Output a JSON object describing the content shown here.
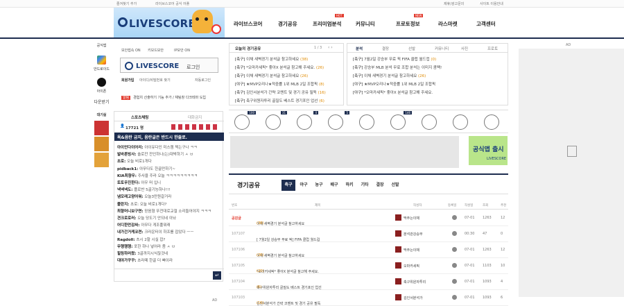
{
  "topbar": {
    "bookmark": "즐겨찾기 추가",
    "official": "라이브스코어 공식 어플",
    "terms": "제휴/광고문의",
    "sitemap": "사이트 이용안내"
  },
  "logo": {
    "text": "LIVESCORE"
  },
  "nav": [
    {
      "label": "라이브스코어"
    },
    {
      "label": "경기공유"
    },
    {
      "label": "프리미엄분석",
      "badge": "HOT"
    },
    {
      "label": "커뮤니티"
    },
    {
      "label": "프로토정보",
      "badge": "NEW"
    },
    {
      "label": "라스마켓"
    },
    {
      "label": "고객센터"
    }
  ],
  "rail": {
    "app": "공식앱",
    "android": "안드로이드",
    "iphone": "아이폰",
    "download": "다운받기",
    "free": "대기실"
  },
  "login": {
    "opt1": "보안접속 ON",
    "opt2": "키보드보안",
    "opt3": "IP보안 ON",
    "btn_logo": "LIVESCORE",
    "btn_label": "로그인",
    "join": "회원가입",
    "find": "아이디/비밀번호 찾기",
    "auto": "자동로그인",
    "info": "경험치 산출하기 기능 추가 / 채팅창 다크테마 도입"
  },
  "chat": {
    "tab1": "스포츠채팅",
    "tab2": "대화금지",
    "count": "17721 명",
    "notice": "욕&음란 금지, 음란글은 반드시 한줄로.",
    "lines": [
      {
        "user": "아이언다이어리:",
        "msg": "아이유다인 미스캠 찍는구나 ㅋㅋ"
      },
      {
        "user": "발바른빙사:",
        "msg": "솔로잔 잔인하나(는)대박하기 ㅅ ㅂ"
      },
      {
        "user": "초로:",
        "msg": "오늘 비로1개다"
      },
      {
        "user": "pidback1:",
        "msg": "아무다도 한골만하기~"
      },
      {
        "user": "KIA최향우:",
        "msg": "주사을 주라 오늘 ㅋㅋㅋㅋㅋㅋㅋㅋㅋ"
      },
      {
        "user": "토토우진한다:",
        "msg": "아우 머 입니"
      },
      {
        "user": "넥넥넥도:",
        "msg": "플로반 5골기능하나!!!"
      },
      {
        "user": "냄모래고양어워:",
        "msg": "오늘3만원갈거라"
      },
      {
        "user": "플란지:",
        "msg": "초로: 오늘 비로1개다?"
      },
      {
        "user": "최향머니보구면:",
        "msg": "믿음형 뚜전대로교절 소리들어야지 ㅋㅋㅋ"
      },
      {
        "user": "견크로로러:",
        "msg": "오늘 당도기 안되네 아놔"
      },
      {
        "user": "어디한먼감싸:",
        "msg": "아무다 게조풀뭐래"
      },
      {
        "user": "내가간거케코켠:",
        "msg": "크라운터이 하프를 잡았다 ㅡㅡ"
      },
      {
        "user": "Ragdoll:",
        "msg": "츠시 2할 시실 잡?"
      },
      {
        "user": "무행행행:",
        "msg": "포한 하나 넣어라 좀 ㅅ ㅂ"
      },
      {
        "user": "힐링하러왔:",
        "msg": "3골까지시식잖것네"
      },
      {
        "user": "대야가꾸꾸:",
        "msg": "초라떼 한골 더 빠이라"
      }
    ]
  },
  "board": {
    "tab": "오늘의 경기공유",
    "page": "1 / 3",
    "posts": [
      {
        "cat": "[축구]",
        "title": "이채  새벽경기 분석글 참고하세요",
        "cnt": "(38)"
      },
      {
        "cat": "[축구]",
        "title": "*오마카세픽* 좋아X 분석글 참고해 주세요.",
        "cnt": "(26)"
      },
      {
        "cat": "[축구]",
        "title": "이채  새벽경기 분석글 참고하세요",
        "cnt": "(26)"
      },
      {
        "cat": "[야구]",
        "title": "★MVP오리나★적중률 1위 MLB 2일 조합픽",
        "cnt": "(8)"
      },
      {
        "cat": "[축구]",
        "title": "김인서분석가  간략 코멘트 및 경기 공유 필독",
        "cnt": "(16)"
      },
      {
        "cat": "[축구]",
        "title": "축구위원자투리  골질도 베스트 경기포인 업선",
        "cnt": "(6)"
      }
    ]
  },
  "tabs2": {
    "tabs": [
      "분석",
      "결장",
      "선발",
      "커뮤니티",
      "사진",
      "프로토"
    ],
    "posts": [
      {
        "cat": "[축구]",
        "title": "7월2일 강승부 무료 픽 FIFA 클럽 월드컵",
        "cnt": "(0)"
      },
      {
        "cat": "[축구]",
        "title": "강승부  MLB 분석 무료 조합 분석는 이미지 콤팩!",
        "cnt": ""
      },
      {
        "cat": "[축구]",
        "title": "이채  새벽경기 분석글 참고하세요",
        "cnt": "(26)"
      },
      {
        "cat": "[야구]",
        "title": "★MVP오리나★적중률 1위 MLB 2일 조합픽",
        "cnt": ""
      },
      {
        "cat": "[야구]",
        "title": "*오마카세픽* 좋아X 분석글 참고해 주세요.",
        "cnt": ""
      },
      {
        "cat": "",
        "title": "",
        "cnt": ""
      }
    ]
  },
  "sports": [
    {
      "icon": "soccer-icon",
      "n": "100"
    },
    {
      "icon": "baseball-icon",
      "n": "31"
    },
    {
      "icon": "basketball-icon",
      "n": "4"
    },
    {
      "icon": "volleyball-icon",
      "n": "5"
    },
    {
      "icon": "hockey-icon",
      "n": ""
    },
    {
      "icon": "tennis-icon",
      "n": "146"
    },
    {
      "icon": "football-icon",
      "n": ""
    },
    {
      "icon": "lol-icon",
      "n": ""
    },
    {
      "icon": "esports-icon",
      "n": ""
    }
  ],
  "ad2": {
    "text": "공식앱 출시",
    "brand": "LIVESCORE"
  },
  "board2": {
    "title": "경기공유",
    "tabs": [
      "축구",
      "야구",
      "농구",
      "배구",
      "하키",
      "기타",
      "결장",
      "선발"
    ],
    "cols": [
      "번호",
      "제목",
      "작성자",
      "등록일",
      "작성일",
      "조회",
      "추천"
    ],
    "rows": [
      {
        "no": "공감글",
        "subj": "이채  새벽경기 분석글 참고하세요",
        "cnt": "(38)",
        "auth": "딱주는이채",
        "dt": "07-01",
        "v": "1263",
        "r": "12"
      },
      {
        "no": "107107",
        "subj": "[ 7월2일 강승부 무료 픽] FIFA 클럽 월드컵",
        "cnt": "",
        "auth": "분석관강승부",
        "dt": "00:30",
        "v": "47",
        "r": "0"
      },
      {
        "no": "107106",
        "subj": "이채  새벽경기 분석글 참고하세요",
        "cnt": "(26)",
        "auth": "딱주는이채",
        "dt": "07-01",
        "v": "1263",
        "r": "12"
      },
      {
        "no": "107105",
        "subj": "*오마카세픽* 좋아X 분석글 참고해 주세요.",
        "cnt": "(20)",
        "auth": "오마카세픽",
        "dt": "07-01",
        "v": "1103",
        "r": "10"
      },
      {
        "no": "107104",
        "subj": "축구위원자투리  골질도 베스트 경기포인 업선",
        "cnt": "(6)",
        "auth": "축구위원자투리",
        "dt": "07-01",
        "v": "1093",
        "r": "4"
      },
      {
        "no": "107103",
        "subj": "김인서분석가  간략 코멘트 및 경기 공유 필독",
        "cnt": "(16)",
        "auth": "김인서분석가",
        "dt": "07-01",
        "v": "1093",
        "r": "6"
      }
    ]
  },
  "ad_label": "AD"
}
